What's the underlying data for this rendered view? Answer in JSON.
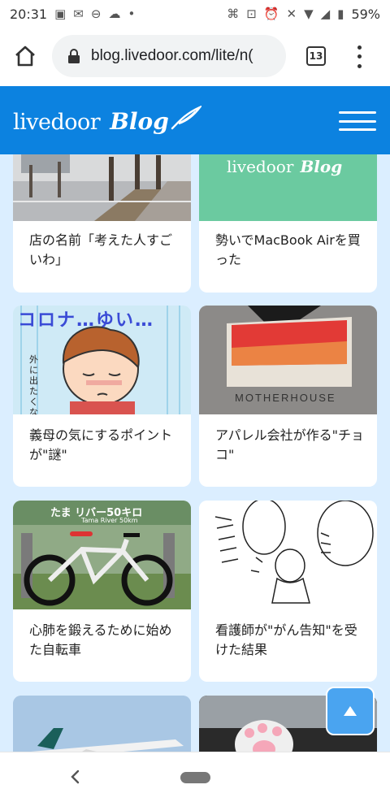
{
  "status_bar": {
    "time": "20:31",
    "battery": "59%",
    "left_icons": [
      "image-icon",
      "mail-icon",
      "sync-icon",
      "cloud-icon",
      "dot-icon"
    ],
    "right_icons": [
      "nfc-icon",
      "voicemail-icon",
      "alarm-icon",
      "mute-icon",
      "wifi-icon",
      "signal-icon",
      "battery-icon"
    ]
  },
  "browser": {
    "url": "blog.livedoor.com/lite/n(",
    "tab_count": "13"
  },
  "site": {
    "logo_text": "livedoor",
    "logo_blog": "Blog",
    "brand_color": "#0c82e0"
  },
  "cards": [
    {
      "title": "店の名前「考えた人すごいわ」",
      "image": "street-photo"
    },
    {
      "title": "勢いでMacBook Airを買った",
      "image": "livedoor-blog-logo-green",
      "image_logo_text": "livedoor",
      "image_logo_blog": "Blog"
    },
    {
      "title": "義母の気にするポイントが\"謎\"",
      "image": "manga-illustration",
      "image_text": "コロナ…ゆい…",
      "image_subtext": "外に出たくない"
    },
    {
      "title": "アパレル会社が作る\"チョコ\"",
      "image": "chocolate-box-photo",
      "image_text": "MOTHERHOUSE"
    },
    {
      "title": "心肺を鍛えるために始めた自転車",
      "image": "bicycle-photo",
      "image_text": "たま リバー50キロ",
      "image_subtext": "Tama River 50km"
    },
    {
      "title": "看護師が\"がん告知\"を受けた結果",
      "image": "sketch-illustration"
    },
    {
      "title": "",
      "image": "airplane-photo"
    },
    {
      "title": "",
      "image": "cat-paw-photo"
    }
  ],
  "scroll_top_button": {
    "icon": "arrow-up-icon",
    "color": "#4aa4f0"
  }
}
